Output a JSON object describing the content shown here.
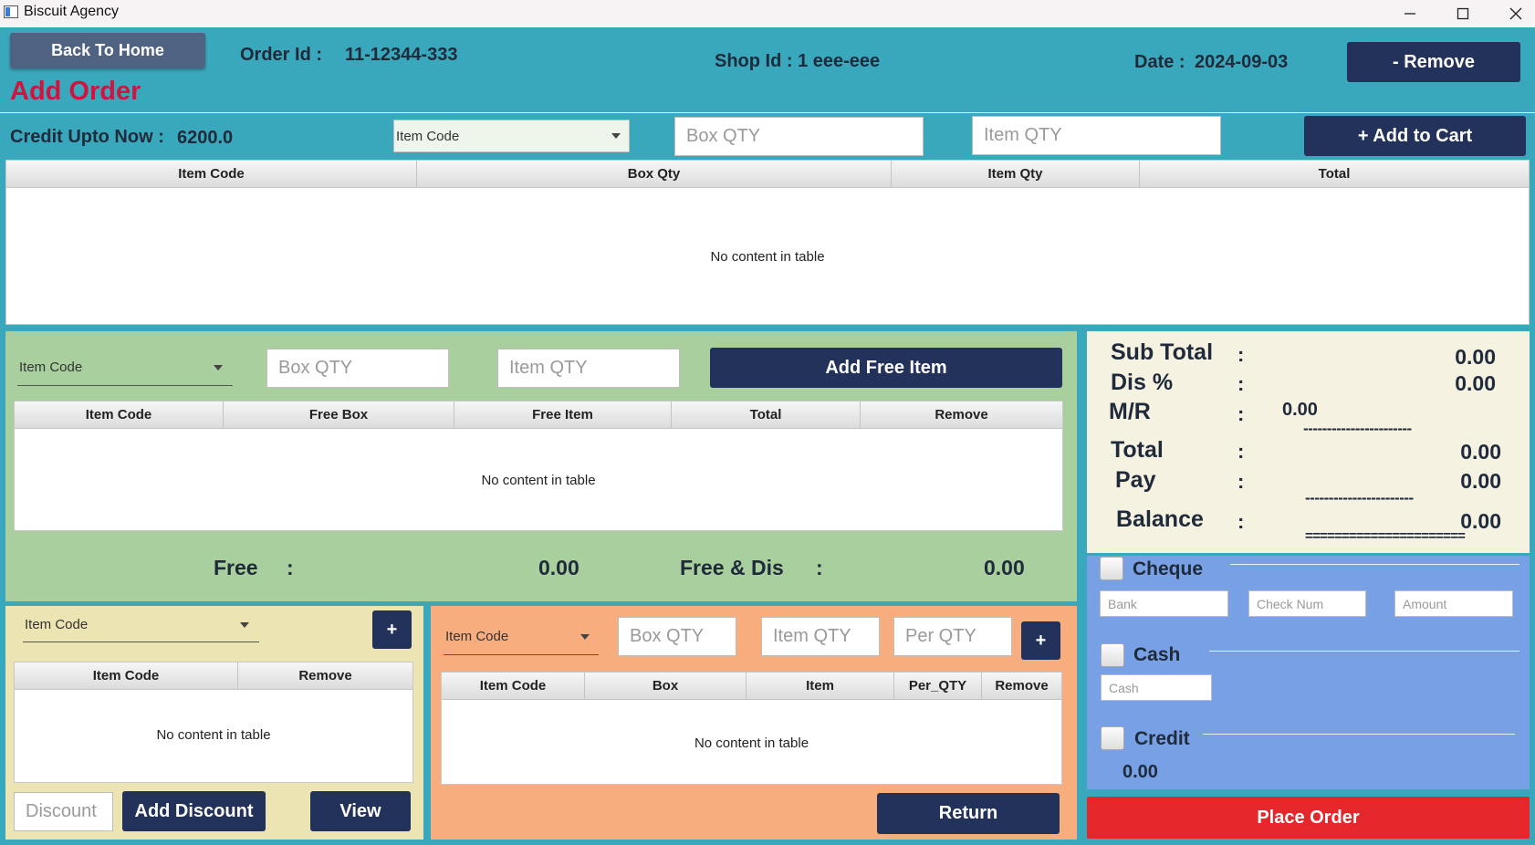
{
  "window": {
    "title": "Biscuit Agency"
  },
  "header": {
    "back_label": "Back To Home",
    "order_id_label": "Order Id :",
    "order_id_value": "11-12344-333",
    "shop_id_text": "Shop Id : 1 eee-eee",
    "date_label": "Date :",
    "date_value": "2024-09-03",
    "remove_label": "- Remove",
    "page_title": "Add Order"
  },
  "cart": {
    "credit_label": "Credit Upto Now :",
    "credit_value": "6200.0",
    "item_code_combo": "Item Code",
    "box_qty_placeholder": "Box QTY",
    "item_qty_placeholder": "Item QTY",
    "add_label": "+ Add to Cart",
    "columns": [
      "Item Code",
      "Box Qty",
      "Item Qty",
      "Total"
    ],
    "empty_text": "No content in table"
  },
  "free": {
    "item_code_combo": "Item Code",
    "box_qty_placeholder": "Box QTY",
    "item_qty_placeholder": "Item QTY",
    "add_label": "Add Free Item",
    "columns": [
      "Item Code",
      "Free Box",
      "Free Item",
      "Total",
      "Remove"
    ],
    "empty_text": "No content in table",
    "free_label": "Free",
    "colon": ":",
    "free_value": "0.00",
    "free_dis_label": "Free & Dis",
    "free_dis_value": "0.00"
  },
  "discount": {
    "item_code_combo": "Item Code",
    "plus_label": "+",
    "columns": [
      "Item Code",
      "Remove"
    ],
    "empty_text": "No content in table",
    "discount_placeholder": "Discount",
    "add_label": "Add Discount",
    "view_label": "View"
  },
  "returns": {
    "item_code_combo": "Item Code",
    "box_qty_placeholder": "Box QTY",
    "item_qty_placeholder": "Item QTY",
    "per_qty_placeholder": "Per QTY",
    "plus_label": "+",
    "columns": [
      "Item Code",
      "Box",
      "Item",
      "Per_QTY",
      "Remove"
    ],
    "empty_text": "No content in table",
    "return_label": "Return"
  },
  "summary": {
    "colon": ":",
    "sub_total_label": "Sub Total",
    "sub_total_value": "0.00",
    "dis_label": "Dis %",
    "dis_value": "0.00",
    "mr_label": "M/R",
    "mr_value": "0.00",
    "dash_line": "-----------------------",
    "total_label": "Total",
    "total_value": "0.00",
    "pay_label": "Pay",
    "pay_value": "0.00",
    "balance_label": "Balance",
    "balance_value": "0.00",
    "double_line": "======================"
  },
  "payment": {
    "cheque_label": "Cheque",
    "bank_placeholder": "Bank",
    "check_num_placeholder": "Check Num",
    "amount_placeholder": "Amount",
    "cash_label": "Cash",
    "cash_placeholder": "Cash",
    "credit_label": "Credit",
    "credit_value": "0.00",
    "place_order_label": "Place Order"
  }
}
